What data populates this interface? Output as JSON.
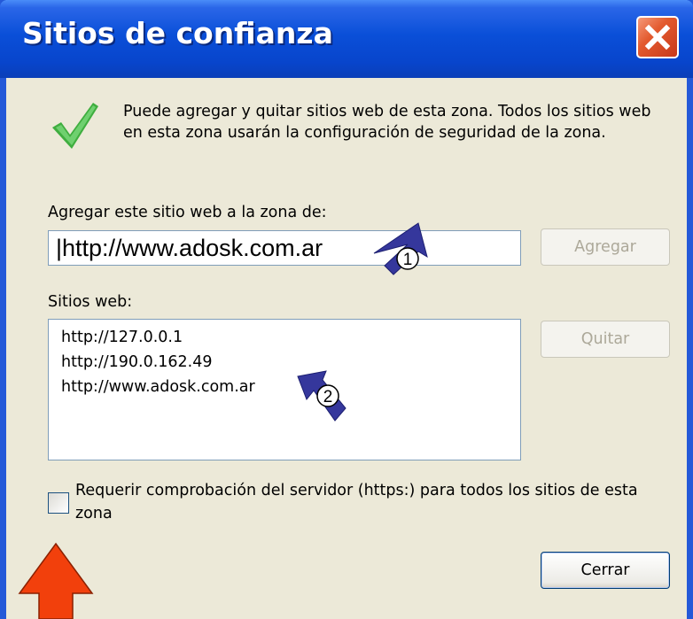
{
  "dialog": {
    "title": "Sitios de confianza",
    "close_icon": "close-icon",
    "info_icon": "checkmark-icon",
    "info_text": "Puede agregar y quitar sitios web de esta zona. Todos los sitios web en esta zona usarán la configuración de seguridad de la zona.",
    "add_label": "Agregar este sitio web a la zona de:",
    "url_value": "|http://www.adosk.com.ar",
    "add_button": "Agregar",
    "sites_label": "Sitios web:",
    "sites": [
      "http://127.0.0.1",
      "http://190.0.162.49",
      "http://www.adosk.com.ar"
    ],
    "remove_button": "Quitar",
    "https_checkbox_checked": false,
    "https_checkbox_label": "Requerir comprobación del servidor (https:) para todos los sitios de esta zona",
    "close_button": "Cerrar"
  },
  "annotations": {
    "marker_1": "1",
    "marker_2": "2"
  },
  "colors": {
    "titlebar": "#0a4fd8",
    "dialog_bg": "#ece9d8",
    "annotation_arrow": "#35379c",
    "red_arrow": "#f2400c"
  }
}
